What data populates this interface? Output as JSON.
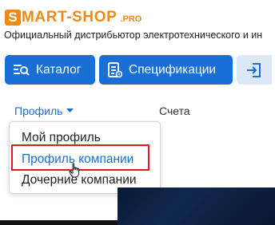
{
  "header": {
    "logo": {
      "letter": "S",
      "name": "MART-SHOP",
      "suffix": ".PRO"
    },
    "tagline": "Официальный дистрибьютор электротехнического и ин"
  },
  "toolbar": {
    "catalog_label": "Каталог",
    "specifications_label": "Спецификации",
    "login_icon": "login-arrow-icon"
  },
  "nav": {
    "profile_label": "Профиль",
    "bills_label": "Счета"
  },
  "profile_menu": {
    "items": [
      {
        "label": "Мой профиль"
      },
      {
        "label": "Профиль компании"
      },
      {
        "label": "Дочерние компании"
      }
    ]
  },
  "colors": {
    "brand_orange": "#f08a14",
    "primary_blue": "#1a6fd6",
    "highlight_red": "#e0191f"
  }
}
